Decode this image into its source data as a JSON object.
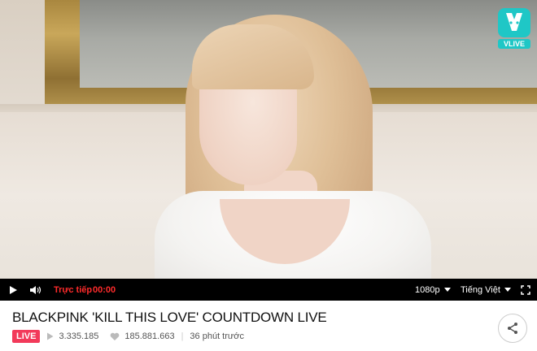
{
  "player": {
    "logo_text": "VLIVE",
    "status_label": "Trực tiếp",
    "time": "00:00",
    "quality": "1080p",
    "subtitle_language": "Tiếng Việt"
  },
  "video_info": {
    "title": "BLACKPINK 'KILL THIS LOVE' COUNTDOWN LIVE",
    "live_badge": "LIVE",
    "plays": "3.335.185",
    "likes": "185.881.663",
    "time_ago": "36 phút trước"
  },
  "icons": {
    "play": "play-icon",
    "volume": "volume-icon",
    "dropdown": "chevron-down-icon",
    "fullscreen": "fullscreen-icon",
    "share": "share-icon",
    "heart": "heart-icon"
  },
  "colors": {
    "accent_live": "#f23a5a",
    "brand": "#1fc7c6",
    "status_red": "#ff2b2b"
  }
}
